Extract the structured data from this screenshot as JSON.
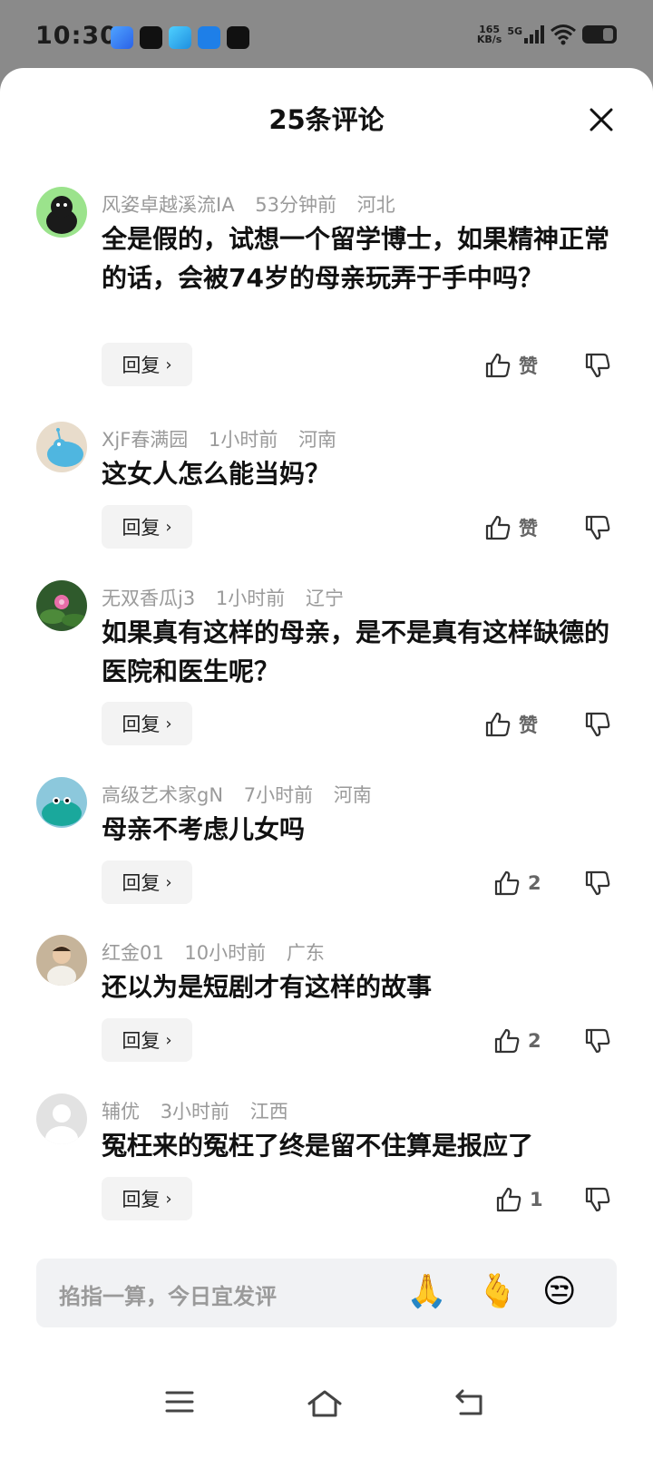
{
  "status": {
    "time": "10:30",
    "net_speed_value": "165",
    "net_speed_unit": "KB/s",
    "signal_label": "5G",
    "app_icons": [
      "browser-icon",
      "tiktok-icon",
      "telegram-icon",
      "app-icon",
      "app-icon"
    ]
  },
  "sheet": {
    "title": "25条评论"
  },
  "comments": [
    {
      "user": "风姿卓越溪流IA",
      "time": "53分钟前",
      "location": "河北",
      "text": "全是假的，试想一个留学博士，如果精神正常的话，会被74岁的母亲玩弄于手中吗？",
      "likes": "赞"
    },
    {
      "user": "XjF春满园",
      "time": "1小时前",
      "location": "河南",
      "text": "这女人怎么能当妈？",
      "likes": "赞"
    },
    {
      "user": "无双香瓜j3",
      "time": "1小时前",
      "location": "辽宁",
      "text": "如果真有这样的母亲，是不是真有这样缺德的医院和医生呢？",
      "likes": "赞"
    },
    {
      "user": "高级艺术家gN",
      "time": "7小时前",
      "location": "河南",
      "text": "母亲不考虑儿女吗",
      "likes": "2"
    },
    {
      "user": "红金01",
      "time": "10小时前",
      "location": "广东",
      "text": "还以为是短剧才有这样的故事",
      "likes": "2"
    },
    {
      "user": "辅优",
      "time": "3小时前",
      "location": "江西",
      "text": "冤枉来的冤枉了终是留不住算是报应了",
      "likes": "1"
    }
  ],
  "reply_label": "回复",
  "input": {
    "placeholder": "掐指一算，今日宜发评",
    "emojis": [
      "🙏",
      "🫰",
      "😒"
    ]
  },
  "colors": {
    "background_dim": "#8a8a8a",
    "sheet": "#ffffff",
    "meta_text": "#9a9a9a",
    "body_text": "#111111",
    "reply_bg": "#f3f3f3"
  }
}
